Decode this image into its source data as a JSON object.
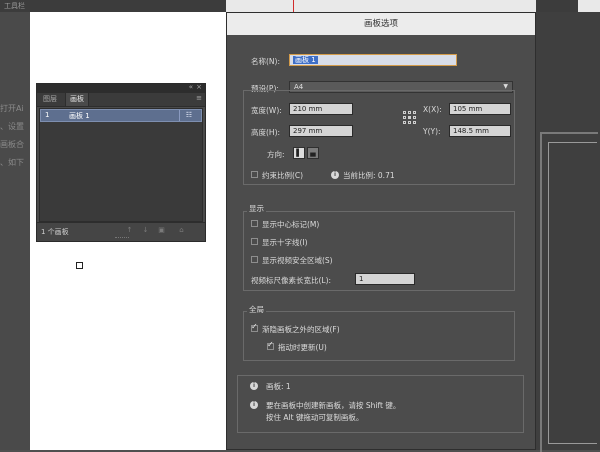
{
  "background": {
    "top_text": "工具栏",
    "left_fragments": [
      "打开Ai",
      "、设置",
      "画板合",
      "、如下"
    ]
  },
  "panel": {
    "tabs": [
      "图层",
      "画板"
    ],
    "collapse_icon": "«",
    "close_icon": "×",
    "menu_icon": "≡",
    "rows": [
      {
        "num": "1",
        "name": "画板 1",
        "icon": "☷"
      }
    ],
    "count_label": "1 个画板",
    "buttons": {
      "up": "↑",
      "down": "↓",
      "new": "▣",
      "delete": "⌂"
    }
  },
  "dialog": {
    "title": "画板选项",
    "name_label": "名称(N):",
    "name_value": "画板 1",
    "preset_label": "预设(P):",
    "preset_value": "A4",
    "preset_arrow": "▼",
    "width_label": "宽度(W):",
    "width_value": "210 mm",
    "height_label": "高度(H):",
    "height_value": "297 mm",
    "x_label": "X(X):",
    "x_value": "105 mm",
    "y_label": "Y(Y):",
    "y_value": "148.5 mm",
    "orientation_label": "方向:",
    "orientation_portrait_glyph": "▌",
    "orientation_landscape_glyph": "▄",
    "constrain_label": "约束比例(C)",
    "current_ratio_label": "当前比例: 0.71",
    "info_glyph": "i",
    "display_legend": "显示",
    "show_center_mark": "显示中心标记(M)",
    "show_crosshairs": "显示十字线(I)",
    "show_video_safe": "显示视频安全区域(S)",
    "pixel_aspect_label": "视频标尺像素长宽比(L):",
    "pixel_aspect_value": "1",
    "global_legend": "全局",
    "fade_outside": "渐隐画板之外的区域(F)",
    "update_drag": "拖动时更新(U)",
    "info_artboards": "画板: 1",
    "info_tip_line1": "要在画板中创建新画板，请按 Shift 键。",
    "info_tip_line2": "按住 Alt 键拖动可复制画板。",
    "checkboxes": {
      "constrain": false,
      "show_center_mark": false,
      "show_crosshairs": false,
      "show_video_safe": false,
      "fade_outside": true,
      "update_drag": true
    }
  }
}
